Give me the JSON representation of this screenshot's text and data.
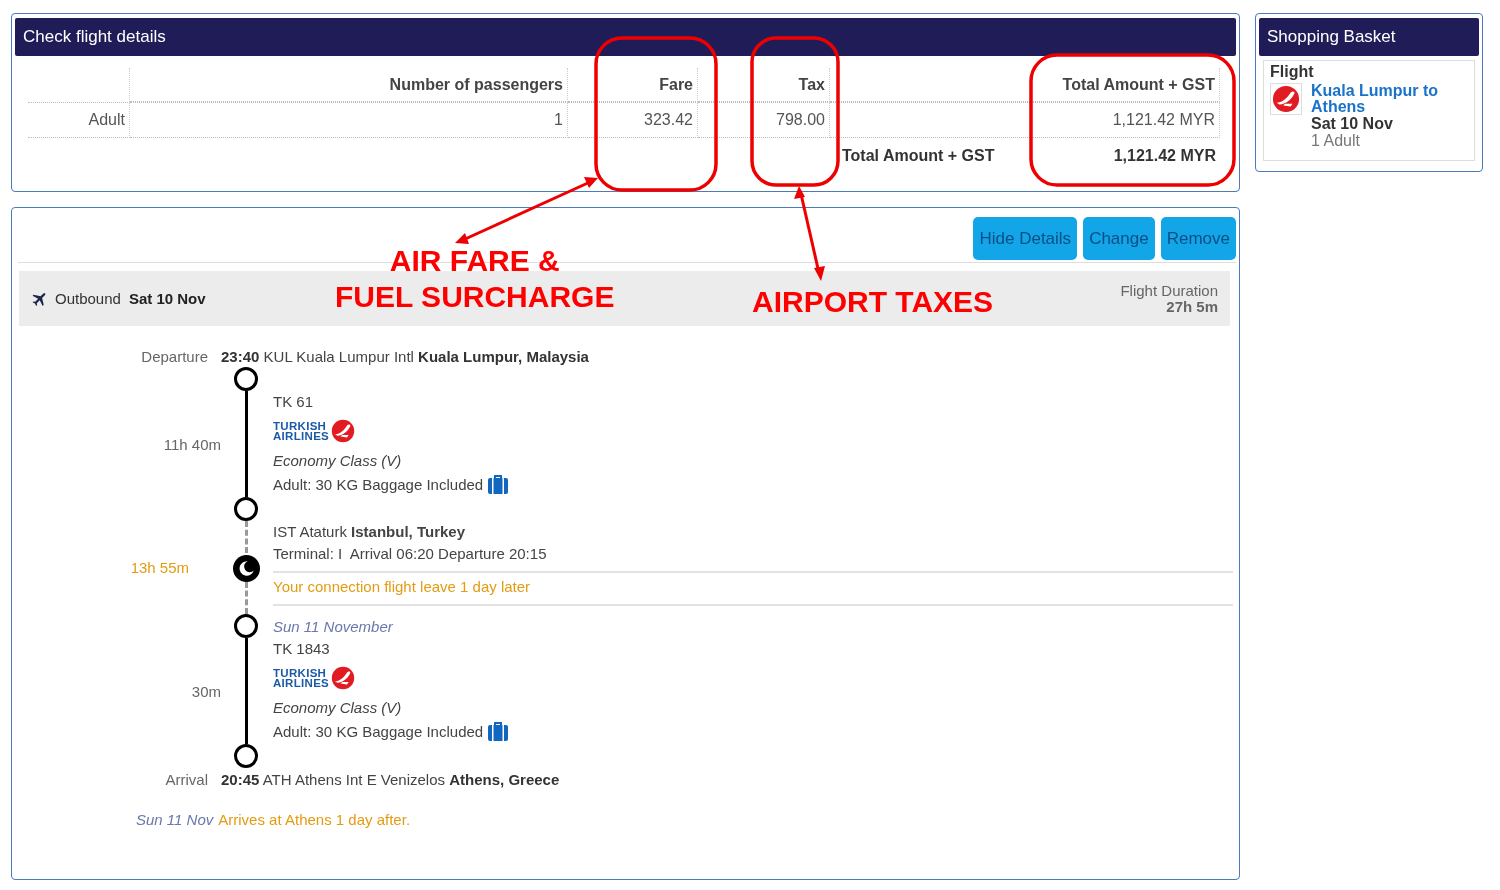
{
  "fare_summary": {
    "title": "Check flight details",
    "columns": [
      "",
      "Number of passengers",
      "Fare",
      "Tax",
      "Total Amount + GST"
    ],
    "rows": [
      {
        "cells": [
          "Adult",
          "1",
          "323.42",
          "798.00",
          "1,121.42 MYR"
        ]
      }
    ],
    "total": {
      "label": "Total Amount + GST",
      "value": "1,121.42 MYR"
    }
  },
  "itinerary": {
    "buttons": [
      "Hide Details",
      "Change",
      "Remove"
    ],
    "outbound": {
      "label": "Outbound",
      "date": "Sat 10 Nov",
      "duration_label": "Flight Duration",
      "duration": "27h 5m"
    },
    "departure": {
      "label": "Departure",
      "text": "**23:40** KUL Kuala Lumpur Intl **Kuala Lumpur, Malaysia**"
    },
    "timeline": [
      {
        "kind": "leg",
        "duration": "11h 40m",
        "flight": "TK 61",
        "airline_logo": [
          "TURKISH",
          "AIRLINES"
        ],
        "cabin": "Economy Class (V)",
        "baggage": "Adult: 30 KG Baggage Included"
      },
      {
        "kind": "layover",
        "duration": "13h 55m",
        "airport": "IST Ataturk **Istanbul, Turkey**",
        "times": "Terminal: I  Arrival 06:20 Departure 20:15",
        "notice": "Your connection flight leave 1 day later"
      },
      {
        "kind": "leg",
        "date": "Sun 11 November",
        "duration": "30m",
        "flight": "TK 1843",
        "airline_logo": [
          "TURKISH",
          "AIRLINES"
        ],
        "cabin": "Economy Class (V)",
        "baggage": "Adult: 30 KG Baggage Included"
      }
    ],
    "arrival": {
      "label": "Arrival",
      "text": "**20:45** ATH Athens Int E Venizelos **Athens, Greece**"
    },
    "footer": {
      "date": "Sun 11 Nov",
      "notice": "Arrives at Athens 1 day after."
    }
  },
  "basket": {
    "title": "Shopping Basket",
    "section": "Flight",
    "route": "Kuala Lumpur to Athens",
    "date": "Sat 10 Nov",
    "passengers": "1 Adult"
  },
  "annotations": [
    {
      "lines": [
        "AIR FARE &",
        "FUEL SURCHARGE"
      ]
    },
    {
      "lines": [
        "AIRPORT TAXES"
      ]
    }
  ]
}
